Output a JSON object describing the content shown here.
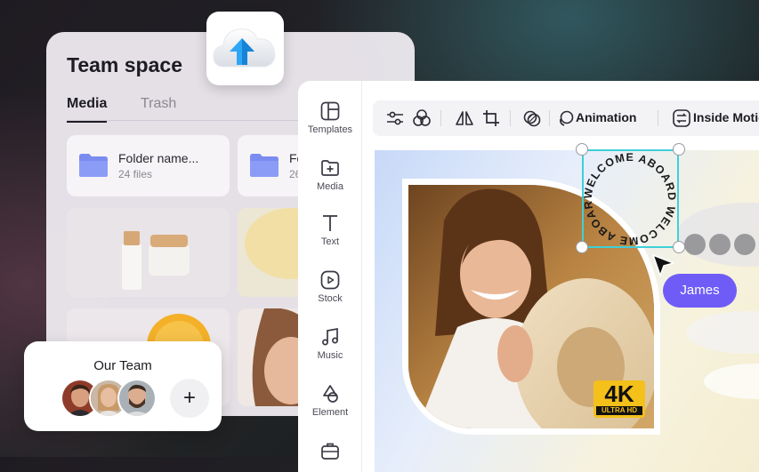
{
  "team_space": {
    "title": "Team space",
    "tabs": [
      {
        "label": "Media",
        "active": true
      },
      {
        "label": "Trash",
        "active": false
      }
    ],
    "folders": [
      {
        "name": "Folder name...",
        "count": "24 files"
      },
      {
        "name": "Fo",
        "count": "26"
      }
    ]
  },
  "editor": {
    "sidebar": [
      {
        "label": "Templates",
        "icon": "templates-icon"
      },
      {
        "label": "Media",
        "icon": "media-add-icon"
      },
      {
        "label": "Text",
        "icon": "text-icon"
      },
      {
        "label": "Stock",
        "icon": "stock-play-icon"
      },
      {
        "label": "Music",
        "icon": "music-icon"
      },
      {
        "label": "Element",
        "icon": "element-shapes-icon"
      }
    ],
    "toolbar": {
      "animation_label": "Animation",
      "inside_motion_label": "Inside Motio"
    }
  },
  "canvas": {
    "circular_text": "WELCOME ABOARD WELCOME ABOARD",
    "cursor_user": "James",
    "badge": {
      "main": "4K",
      "sub": "ULTRA HD"
    }
  },
  "our_team": {
    "title": "Our Team",
    "add_label": "+"
  },
  "colors": {
    "accent": "#6f5cf7",
    "selection": "#3fd0d8",
    "folder": "#7b8cf0"
  }
}
